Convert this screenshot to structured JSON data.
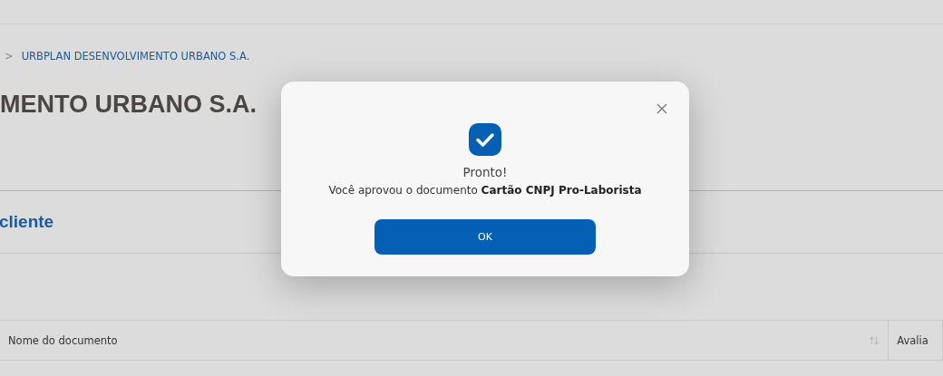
{
  "breadcrumb": {
    "separator": ">",
    "link": "URBPLAN DESENVOLVIMENTO URBANO S.A."
  },
  "heading": "MENTO URBANO S.A.",
  "section_title": "cliente",
  "table": {
    "columns": [
      {
        "label": "Nome do documento",
        "sortable": true
      },
      {
        "label": "Avalia",
        "sortable": false
      }
    ]
  },
  "dialog": {
    "title": "Pronto!",
    "message": "Você aprovou o documento **Cartão CNPJ Pro-Laborista**",
    "button": "OK"
  }
}
